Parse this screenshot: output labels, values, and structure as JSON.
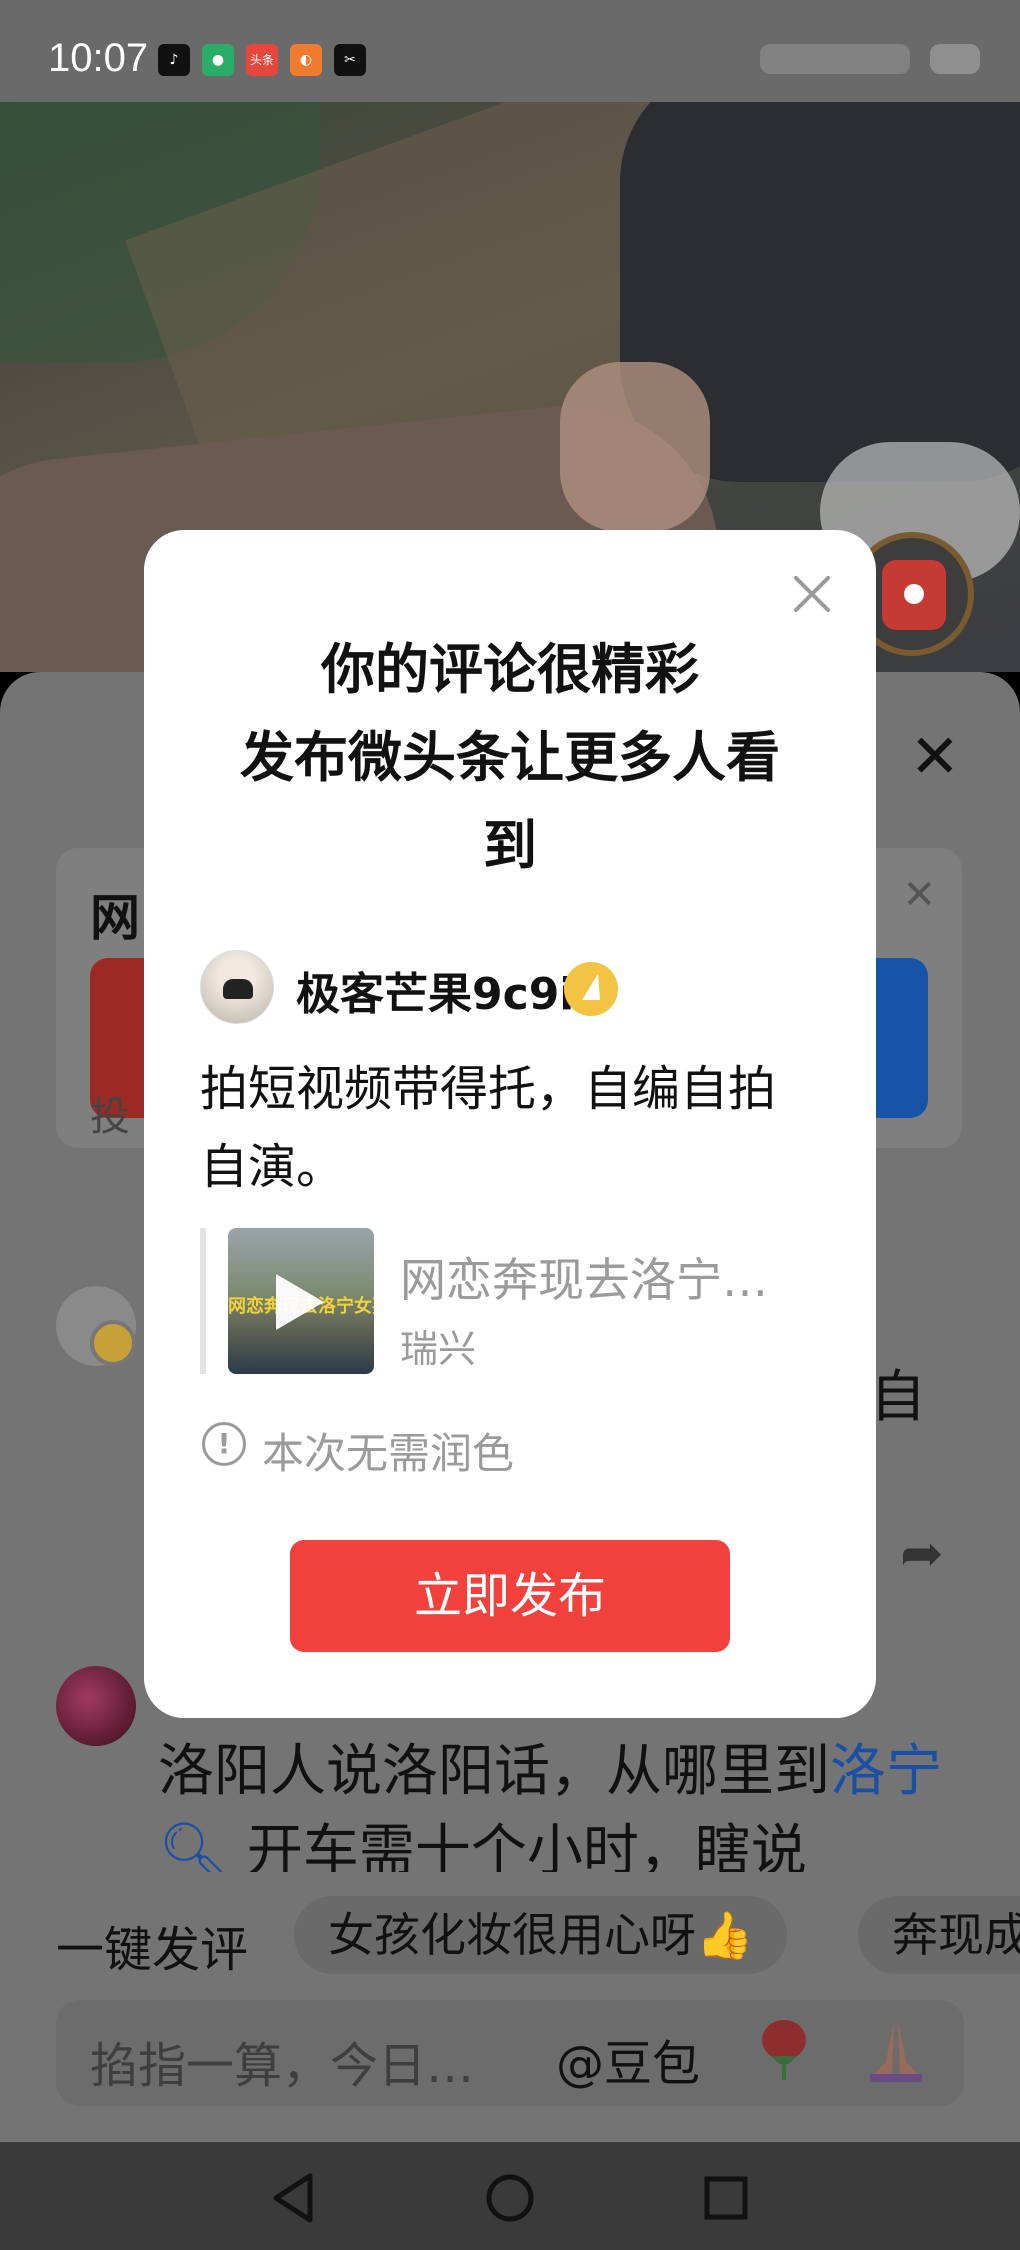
{
  "status_bar": {
    "time": "10:07",
    "apps": [
      {
        "icon": "tiktok-icon",
        "glyph": "♪",
        "color": "#111111"
      },
      {
        "icon": "wechat-icon",
        "glyph": "●",
        "color": "#2aae67"
      },
      {
        "icon": "toutiao-icon",
        "glyph": "头条",
        "color": "#e8463d"
      },
      {
        "icon": "app-icon",
        "glyph": "◐",
        "color": "#f07b2e"
      },
      {
        "icon": "capcut-icon",
        "glyph": "✂",
        "color": "#111111"
      }
    ]
  },
  "background": {
    "vote_card_title": "网",
    "vote_card_footer": "投",
    "comment2_text": "洛阳人说洛阳话，从哪里到",
    "comment2_link": "洛宁",
    "comment2_cont": "开车需十个小时，瞎说",
    "bg_char": "自",
    "quick_label": "一键发评",
    "quick_chips": [
      "女孩化妆很用心呀👍",
      "奔现成"
    ],
    "input_placeholder": "掐指一算，今日…",
    "input_doubao": "@豆包"
  },
  "modal": {
    "title_lines": [
      "你的评论很精彩",
      "发布微头条让更多人看",
      "到"
    ],
    "username": "极客芒果9c9i",
    "comment": "拍短视频带得托，自编自拍自演。",
    "quoted_title": "网恋奔现去洛宁…",
    "quoted_author": "瑞兴",
    "thumb_caption": "网恋奔现去洛宁女孩",
    "notice_text": "本次无需润色",
    "publish_label": "立即发布"
  },
  "colors": {
    "publish_button": "#f2403d",
    "link_blue": "#1b4fa6",
    "scrim": "#747474"
  }
}
